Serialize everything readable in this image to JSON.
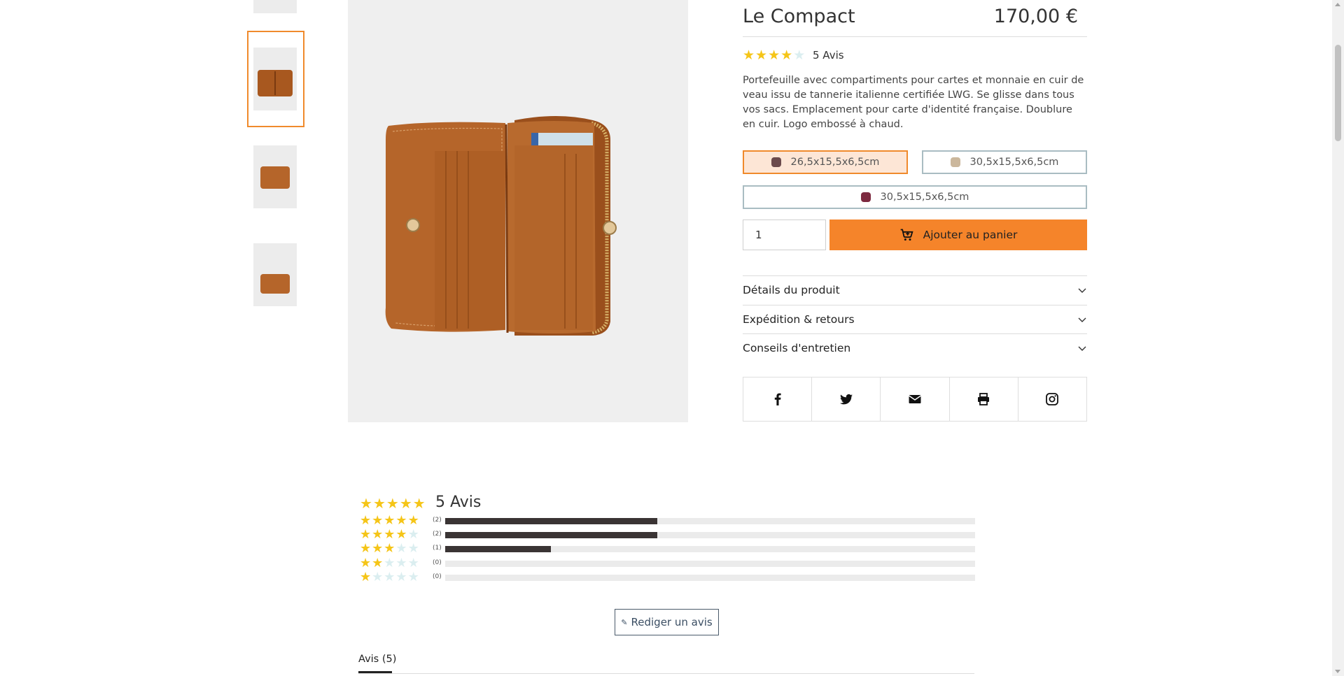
{
  "product": {
    "title": "Le Compact",
    "price": "170,00 €",
    "rating": 4,
    "reviews_label": "5 Avis",
    "description": "Portefeuille avec compartiments pour cartes et monnaie en cuir de veau issu de tannerie italienne certifiée  LWG. Se glisse dans tous vos sacs. Emplacement pour carte d'identité française.  Doublure en cuir.  Logo embossé à chaud."
  },
  "variants": [
    {
      "label": "26,5x15,5x6,5cm",
      "color": "#6b4a4c",
      "selected": true
    },
    {
      "label": "30,5x15,5x6,5cm",
      "color": "#cbb79c",
      "selected": false
    },
    {
      "label": "30,5x15,5x6,5cm",
      "color": "#7d2a40",
      "selected": false
    }
  ],
  "cart": {
    "quantity": "1",
    "add_label": "Ajouter au panier"
  },
  "accordion": [
    {
      "label": "Détails du produit"
    },
    {
      "label": "Expédition & retours"
    },
    {
      "label": "Conseils d'entretien"
    }
  ],
  "share_icons": [
    "facebook-icon",
    "twitter-icon",
    "email-icon",
    "print-icon",
    "instagram-icon"
  ],
  "reviews": {
    "summary_rating": 5,
    "count_label": "5 Avis",
    "distribution": [
      {
        "stars": 5,
        "count_label": "(2)",
        "fraction": 0.4
      },
      {
        "stars": 4,
        "count_label": "(2)",
        "fraction": 0.4
      },
      {
        "stars": 3,
        "count_label": "(1)",
        "fraction": 0.2
      },
      {
        "stars": 2,
        "count_label": "(0)",
        "fraction": 0
      },
      {
        "stars": 1,
        "count_label": "(0)",
        "fraction": 0
      }
    ],
    "write_label": "Rediger un avis",
    "tab_label": "Avis (5)"
  },
  "colors": {
    "accent": "#f5842a",
    "star": "#f5c518",
    "star_empty": "#dbeef0",
    "leather": "#b5652a"
  }
}
